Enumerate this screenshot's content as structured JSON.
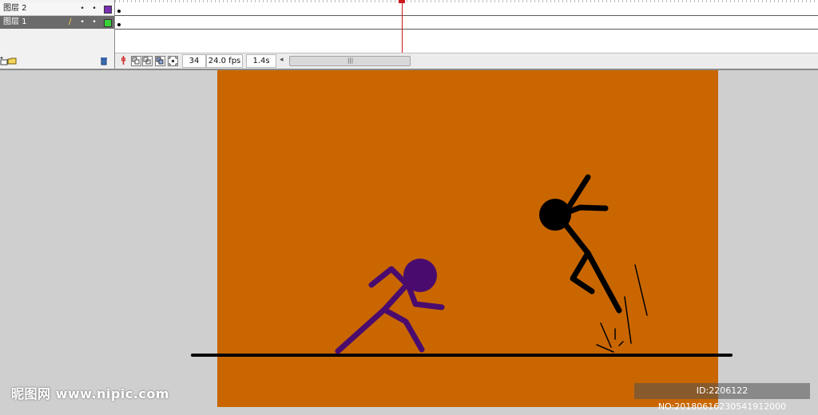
{
  "timeline": {
    "layers": [
      {
        "name": "图层 2",
        "color": "#7a2fb3",
        "selected": false
      },
      {
        "name": "图层 1",
        "color": "#39d339",
        "selected": true
      }
    ],
    "current_frame": "34",
    "fps": "24.0 fps",
    "time": "1.4s",
    "icons": {
      "add_layer": "add-layer-icon",
      "add_folder": "add-folder-icon",
      "delete": "trash-icon"
    }
  },
  "stage": {
    "background": "#c96600",
    "ground_color": "#000000",
    "figures": [
      {
        "name": "purple-stick-figure",
        "color": "#4a0b6e"
      },
      {
        "name": "black-stick-figure",
        "color": "#000000"
      }
    ]
  },
  "watermark": {
    "left": "昵图网 www.nipic.com",
    "right": "ID:2206122 NO:20180616230541912000"
  }
}
